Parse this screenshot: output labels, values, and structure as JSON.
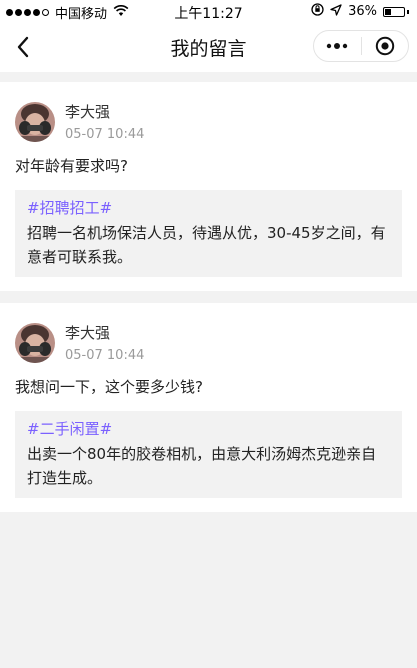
{
  "status_bar": {
    "carrier": "中国移动",
    "time": "上午11:27",
    "battery_text": "36%",
    "battery_level": 0.36,
    "icons": [
      "wifi-icon",
      "orientation-lock-icon",
      "location-arrow-icon",
      "battery-icon"
    ]
  },
  "nav": {
    "title": "我的留言",
    "back_icon": "chevron-left-icon",
    "more_icon": "more-dots-icon",
    "close_icon": "target-close-icon"
  },
  "messages": [
    {
      "user_name": "李大强",
      "time": "05-07 10:44",
      "text": "对年龄有要求吗?",
      "quote": {
        "tag": "#招聘招工#",
        "text": "招聘一名机场保洁人员，待遇从优，30-45岁之间，有意者可联系我。"
      }
    },
    {
      "user_name": "李大强",
      "time": "05-07 10:44",
      "text": "我想问一下，这个要多少钱?",
      "quote": {
        "tag": "#二手闲置#",
        "text": "出卖一个80年的胶卷相机，由意大利汤姆杰克逊亲自打造生成。"
      }
    }
  ],
  "colors": {
    "accent_tag": "#7b61ff",
    "background": "#f2f2f2",
    "card": "#ffffff",
    "time_text": "#9a9a9a"
  }
}
